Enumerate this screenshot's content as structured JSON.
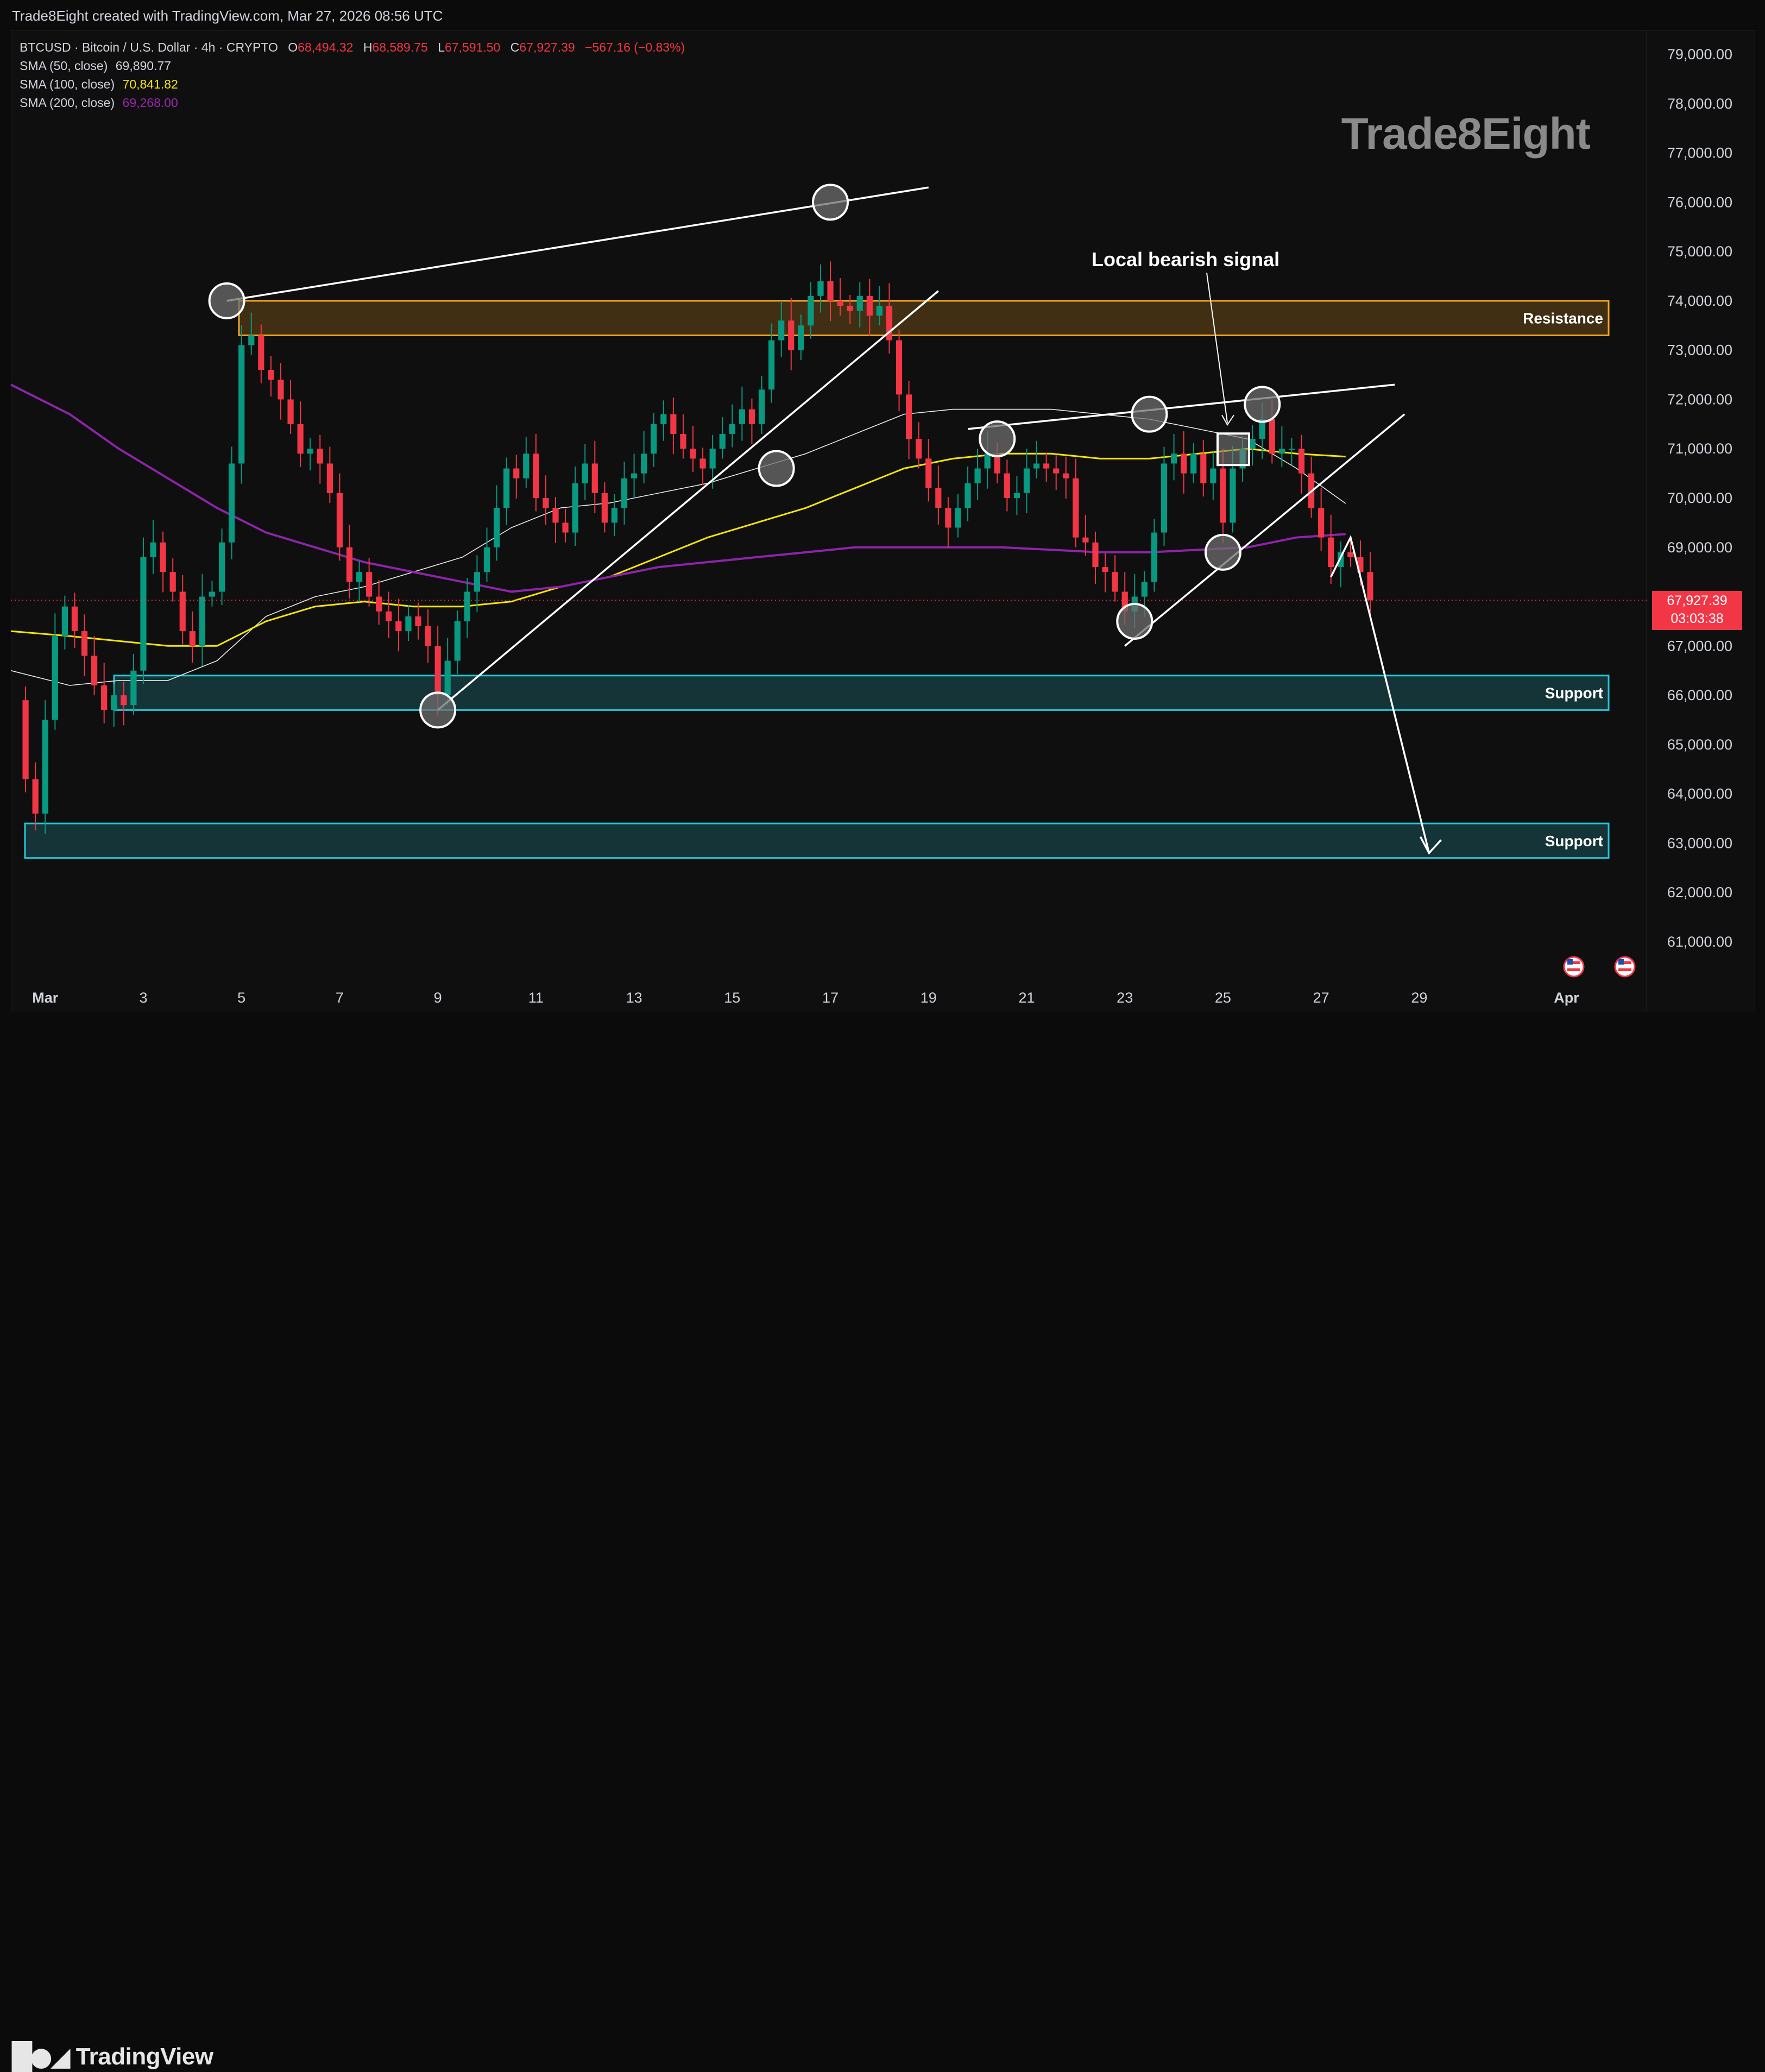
{
  "header": {
    "credit": "Trade8Eight created with TradingView.com, Mar 27, 2026 08:56 UTC"
  },
  "legend": {
    "symbol": "BTCUSD · Bitcoin / U.S. Dollar · 4h · CRYPTO",
    "open_label": "O",
    "open": "68,494.32",
    "high_label": "H",
    "high": "68,589.75",
    "low_label": "L",
    "low": "67,591.50",
    "close_label": "C",
    "close": "67,927.39",
    "change": "−567.16 (−0.83%)",
    "sma50_label": "SMA (50, close)",
    "sma50_value": "69,890.77",
    "sma100_label": "SMA (100, close)",
    "sma100_value": "70,841.82",
    "sma200_label": "SMA (200, close)",
    "sma200_value": "69,268.00"
  },
  "watermark": "Trade8Eight",
  "annotations": {
    "bearish_signal": "Local bearish signal",
    "resistance": "Resistance",
    "support_upper": "Support",
    "support_lower": "Support"
  },
  "price_tag": {
    "price": "67,927.39",
    "countdown": "03:03:38"
  },
  "footer": {
    "brand": "TradingView"
  },
  "icons": [
    "us-flag-icon",
    "us-flag-icon",
    "tradingview-logo-icon"
  ],
  "colors": {
    "bull": "#089981",
    "bear": "#f23645",
    "sma50": "#e8e8e8",
    "sma100": "#f7e600",
    "sma200": "#8e24aa",
    "resistance_zone": "#f5a623",
    "support_zone": "#26c6da"
  },
  "chart_data": {
    "type": "candlestick",
    "title": "BTCUSD · Bitcoin / U.S. Dollar · 4h · CRYPTO",
    "x_labels": [
      "Mar",
      "3",
      "5",
      "7",
      "9",
      "11",
      "13",
      "15",
      "17",
      "19",
      "21",
      "23",
      "25",
      "27",
      "29",
      "Apr"
    ],
    "x_label_days": [
      1,
      3,
      5,
      7,
      9,
      11,
      13,
      15,
      17,
      19,
      21,
      23,
      25,
      27,
      29,
      32
    ],
    "y_ticks": [
      "79,000.00",
      "78,000.00",
      "77,000.00",
      "76,000.00",
      "75,000.00",
      "74,000.00",
      "73,000.00",
      "72,000.00",
      "71,000.00",
      "70,000.00",
      "69,000.00",
      "67,000.00",
      "66,000.00",
      "65,000.00",
      "64,000.00",
      "63,000.00",
      "62,000.00",
      "61,000.00"
    ],
    "y_tick_values": [
      79000,
      78000,
      77000,
      76000,
      75000,
      74000,
      73000,
      72000,
      71000,
      70000,
      69000,
      67000,
      66000,
      65000,
      64000,
      63000,
      62000,
      61000
    ],
    "ylim": [
      60000,
      79500
    ],
    "xlim_days": [
      0.3,
      33.5
    ],
    "close_price": 67927.39,
    "close_points": [
      [
        0.4,
        65900
      ],
      [
        0.6,
        64300
      ],
      [
        0.8,
        63600
      ],
      [
        1.0,
        65500
      ],
      [
        1.2,
        67200
      ],
      [
        1.4,
        67800
      ],
      [
        1.6,
        67300
      ],
      [
        1.8,
        66800
      ],
      [
        2.0,
        66200
      ],
      [
        2.2,
        65700
      ],
      [
        2.4,
        66000
      ],
      [
        2.6,
        65800
      ],
      [
        2.8,
        66500
      ],
      [
        3.0,
        68800
      ],
      [
        3.2,
        69100
      ],
      [
        3.4,
        68500
      ],
      [
        3.6,
        68100
      ],
      [
        3.8,
        67300
      ],
      [
        4.0,
        67000
      ],
      [
        4.2,
        68000
      ],
      [
        4.4,
        68100
      ],
      [
        4.6,
        69100
      ],
      [
        4.8,
        70700
      ],
      [
        5.0,
        73100
      ],
      [
        5.2,
        73300
      ],
      [
        5.4,
        72600
      ],
      [
        5.6,
        72400
      ],
      [
        5.8,
        72000
      ],
      [
        6.0,
        71500
      ],
      [
        6.2,
        70900
      ],
      [
        6.4,
        71000
      ],
      [
        6.6,
        70700
      ],
      [
        6.8,
        70100
      ],
      [
        7.0,
        69000
      ],
      [
        7.2,
        68300
      ],
      [
        7.4,
        68500
      ],
      [
        7.6,
        68000
      ],
      [
        7.8,
        67700
      ],
      [
        8.0,
        67500
      ],
      [
        8.2,
        67300
      ],
      [
        8.4,
        67600
      ],
      [
        8.6,
        67400
      ],
      [
        8.8,
        67000
      ],
      [
        9.0,
        66000
      ],
      [
        9.2,
        66700
      ],
      [
        9.4,
        67500
      ],
      [
        9.6,
        68100
      ],
      [
        9.8,
        68500
      ],
      [
        10.0,
        69000
      ],
      [
        10.2,
        69800
      ],
      [
        10.4,
        70600
      ],
      [
        10.6,
        70400
      ],
      [
        10.8,
        70900
      ],
      [
        11.0,
        70000
      ],
      [
        11.2,
        69800
      ],
      [
        11.4,
        69500
      ],
      [
        11.6,
        69300
      ],
      [
        11.8,
        70300
      ],
      [
        12.0,
        70700
      ],
      [
        12.2,
        70100
      ],
      [
        12.4,
        69500
      ],
      [
        12.6,
        69800
      ],
      [
        12.8,
        70400
      ],
      [
        13.0,
        70500
      ],
      [
        13.2,
        70900
      ],
      [
        13.4,
        71500
      ],
      [
        13.6,
        71700
      ],
      [
        13.8,
        71300
      ],
      [
        14.0,
        71000
      ],
      [
        14.2,
        70800
      ],
      [
        14.4,
        70600
      ],
      [
        14.6,
        71000
      ],
      [
        14.8,
        71300
      ],
      [
        15.0,
        71500
      ],
      [
        15.2,
        71800
      ],
      [
        15.4,
        71500
      ],
      [
        15.6,
        72200
      ],
      [
        15.8,
        73200
      ],
      [
        16.0,
        73600
      ],
      [
        16.2,
        73000
      ],
      [
        16.4,
        73500
      ],
      [
        16.6,
        74100
      ],
      [
        16.8,
        74400
      ],
      [
        17.0,
        74000
      ],
      [
        17.2,
        73900
      ],
      [
        17.4,
        73800
      ],
      [
        17.6,
        74100
      ],
      [
        17.8,
        73700
      ],
      [
        18.0,
        73900
      ],
      [
        18.2,
        73200
      ],
      [
        18.4,
        72100
      ],
      [
        18.6,
        71200
      ],
      [
        18.8,
        70800
      ],
      [
        19.0,
        70200
      ],
      [
        19.2,
        69800
      ],
      [
        19.4,
        69400
      ],
      [
        19.6,
        69800
      ],
      [
        19.8,
        70300
      ],
      [
        20.0,
        70600
      ],
      [
        20.2,
        70900
      ],
      [
        20.4,
        70500
      ],
      [
        20.6,
        70000
      ],
      [
        20.8,
        70100
      ],
      [
        21.0,
        70600
      ],
      [
        21.2,
        70700
      ],
      [
        21.4,
        70600
      ],
      [
        21.6,
        70500
      ],
      [
        21.8,
        70400
      ],
      [
        22.0,
        69200
      ],
      [
        22.2,
        69100
      ],
      [
        22.4,
        68600
      ],
      [
        22.6,
        68500
      ],
      [
        22.8,
        68100
      ],
      [
        23.0,
        67700
      ],
      [
        23.2,
        68000
      ],
      [
        23.4,
        68300
      ],
      [
        23.6,
        69300
      ],
      [
        23.8,
        70700
      ],
      [
        24.0,
        70900
      ],
      [
        24.2,
        70500
      ],
      [
        24.4,
        70900
      ],
      [
        24.6,
        70300
      ],
      [
        24.8,
        70600
      ],
      [
        25.0,
        69500
      ],
      [
        25.2,
        70600
      ],
      [
        25.4,
        71000
      ],
      [
        25.6,
        71200
      ],
      [
        25.8,
        71600
      ],
      [
        26.0,
        70900
      ],
      [
        26.2,
        71000
      ],
      [
        26.4,
        71000
      ],
      [
        26.6,
        70500
      ],
      [
        26.8,
        69800
      ],
      [
        27.0,
        69200
      ],
      [
        27.2,
        68600
      ],
      [
        27.4,
        68900
      ],
      [
        27.6,
        68800
      ],
      [
        27.8,
        68500
      ],
      [
        28.0,
        67927
      ]
    ],
    "series": [
      {
        "name": "SMA (50, close)",
        "points": [
          [
            0.3,
            66500
          ],
          [
            1.5,
            66200
          ],
          [
            2.5,
            66300
          ],
          [
            3.5,
            66300
          ],
          [
            4.5,
            66700
          ],
          [
            5.5,
            67600
          ],
          [
            6.5,
            68000
          ],
          [
            7.5,
            68200
          ],
          [
            8.5,
            68500
          ],
          [
            9.5,
            68800
          ],
          [
            10.5,
            69400
          ],
          [
            11.5,
            69800
          ],
          [
            12.5,
            69900
          ],
          [
            13.5,
            70100
          ],
          [
            14.5,
            70300
          ],
          [
            15.5,
            70600
          ],
          [
            16.5,
            70900
          ],
          [
            17.5,
            71300
          ],
          [
            18.5,
            71700
          ],
          [
            19.5,
            71800
          ],
          [
            20.5,
            71800
          ],
          [
            21.5,
            71800
          ],
          [
            22.5,
            71700
          ],
          [
            23.5,
            71600
          ],
          [
            24.5,
            71400
          ],
          [
            25.5,
            71200
          ],
          [
            26.5,
            70600
          ],
          [
            27.5,
            69890
          ]
        ]
      },
      {
        "name": "SMA (100, close)",
        "points": [
          [
            0.3,
            67300
          ],
          [
            1.5,
            67200
          ],
          [
            2.5,
            67100
          ],
          [
            3.5,
            67000
          ],
          [
            4.5,
            67000
          ],
          [
            5.5,
            67500
          ],
          [
            6.5,
            67800
          ],
          [
            7.5,
            67900
          ],
          [
            8.5,
            67800
          ],
          [
            9.5,
            67800
          ],
          [
            10.5,
            67900
          ],
          [
            11.5,
            68200
          ],
          [
            12.5,
            68400
          ],
          [
            13.5,
            68800
          ],
          [
            14.5,
            69200
          ],
          [
            15.5,
            69500
          ],
          [
            16.5,
            69800
          ],
          [
            17.5,
            70200
          ],
          [
            18.5,
            70600
          ],
          [
            19.5,
            70800
          ],
          [
            20.5,
            70900
          ],
          [
            21.5,
            70900
          ],
          [
            22.5,
            70800
          ],
          [
            23.5,
            70800
          ],
          [
            24.5,
            70900
          ],
          [
            25.5,
            71000
          ],
          [
            26.5,
            70900
          ],
          [
            27.5,
            70841
          ]
        ]
      },
      {
        "name": "SMA (200, close)",
        "points": [
          [
            0.3,
            72300
          ],
          [
            1.5,
            71700
          ],
          [
            2.5,
            71000
          ],
          [
            3.5,
            70400
          ],
          [
            4.5,
            69800
          ],
          [
            5.5,
            69300
          ],
          [
            6.5,
            69000
          ],
          [
            7.5,
            68700
          ],
          [
            8.5,
            68500
          ],
          [
            9.5,
            68300
          ],
          [
            10.5,
            68100
          ],
          [
            11.5,
            68200
          ],
          [
            12.5,
            68400
          ],
          [
            13.5,
            68600
          ],
          [
            14.5,
            68700
          ],
          [
            15.5,
            68800
          ],
          [
            16.5,
            68900
          ],
          [
            17.5,
            69000
          ],
          [
            18.5,
            69000
          ],
          [
            19.5,
            69000
          ],
          [
            20.5,
            69000
          ],
          [
            21.5,
            68950
          ],
          [
            22.5,
            68900
          ],
          [
            23.5,
            68900
          ],
          [
            24.5,
            68950
          ],
          [
            25.5,
            69000
          ],
          [
            26.5,
            69200
          ],
          [
            27.5,
            69268
          ]
        ]
      }
    ],
    "zones": [
      {
        "label": "Resistance",
        "low": 73300,
        "high": 74000
      },
      {
        "label": "Support",
        "low": 65700,
        "high": 66400
      },
      {
        "label": "Support",
        "low": 62700,
        "high": 63400
      }
    ],
    "trendlines": [
      {
        "from": [
          4.7,
          74000
        ],
        "to": [
          19.0,
          76300
        ]
      },
      {
        "from": [
          9.0,
          65700
        ],
        "to": [
          19.2,
          74200
        ]
      },
      {
        "from": [
          19.8,
          71400
        ],
        "to": [
          28.5,
          72300
        ]
      },
      {
        "from": [
          23.0,
          67000
        ],
        "to": [
          28.7,
          71700
        ]
      }
    ],
    "projection": [
      [
        27.2,
        68400
      ],
      [
        27.6,
        69200
      ],
      [
        29.2,
        62800
      ]
    ],
    "markers": [
      [
        4.7,
        74000
      ],
      [
        9.0,
        65700
      ],
      [
        15.9,
        70600
      ],
      [
        17.0,
        76000
      ],
      [
        20.4,
        71200
      ],
      [
        23.2,
        67500
      ],
      [
        23.5,
        71700
      ],
      [
        25.0,
        68900
      ],
      [
        25.8,
        71900
      ]
    ]
  }
}
